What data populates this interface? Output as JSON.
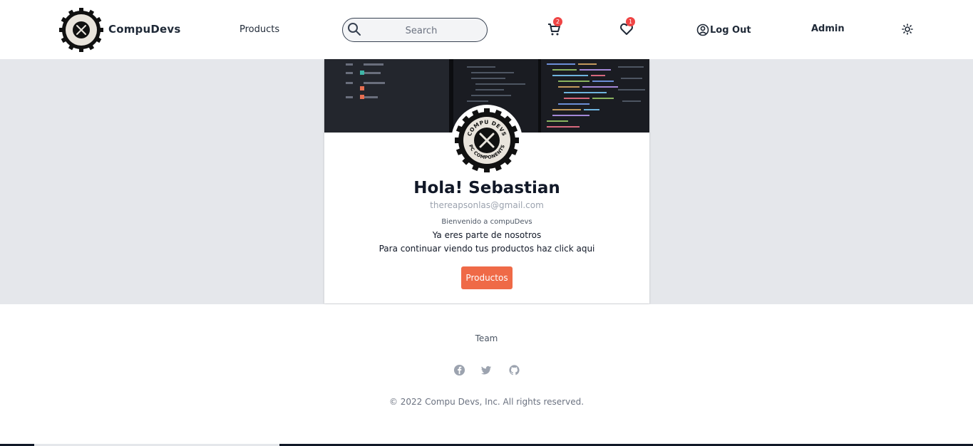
{
  "header": {
    "brand": "CompuDevs",
    "nav_products": "Products",
    "search_placeholder": "Search",
    "cart_count": "2",
    "wishlist_count": "1",
    "logout_label": "Log Out",
    "admin_label": "Admin",
    "icons": {
      "search": "search-icon",
      "cart": "cart-icon",
      "wishlist": "heart-icon",
      "user": "user-circle-icon",
      "theme": "sun-icon"
    }
  },
  "logo": {
    "top_text": "COMPU DEVS",
    "bottom_text": "PC COMPONENTS"
  },
  "profile": {
    "greeting": "Hola! Sebastian",
    "email": "thereapsonlas@gmail.com",
    "welcome": "Bienvenido a compuDevs",
    "line1": "Ya eres parte de nosotros",
    "line2": "Para continuar viendo tus productos haz click aqui",
    "button_label": "Productos"
  },
  "footer": {
    "team_link": "Team",
    "socials": [
      "facebook-icon",
      "twitter-icon",
      "github-icon"
    ],
    "copyright": "© 2022 Compu Devs, Inc. All rights reserved."
  },
  "colors": {
    "accent": "#ef6a47",
    "badge": "#ef4444",
    "page_bg": "#e5e7eb",
    "text": "#111827"
  }
}
